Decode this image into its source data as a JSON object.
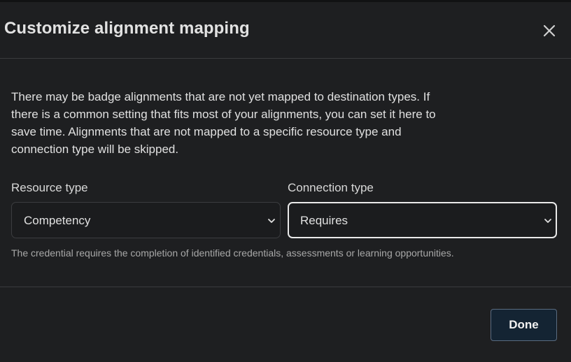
{
  "dialog": {
    "title": "Customize alignment mapping",
    "close_icon": "close-icon",
    "description": "There may be badge alignments that are not yet mapped to destination types. If there is a common setting that fits most of your alignments, you can set it here to save time. Alignments that are not mapped to a specific resource type and connection type will be skipped.",
    "resource_type": {
      "label": "Resource type",
      "selected": "Competency",
      "icon": "chevron-down-icon"
    },
    "connection_type": {
      "label": "Connection type",
      "selected": "Requires",
      "icon": "chevron-down-icon"
    },
    "help_text": "The credential requires the completion of identified credentials, assessments or learning opportunities.",
    "done_label": "Done"
  },
  "colors": {
    "background": "#1e1f21",
    "button_background": "#142433",
    "focus_border": "#eaeaea",
    "divider": "#3a3b3e"
  }
}
